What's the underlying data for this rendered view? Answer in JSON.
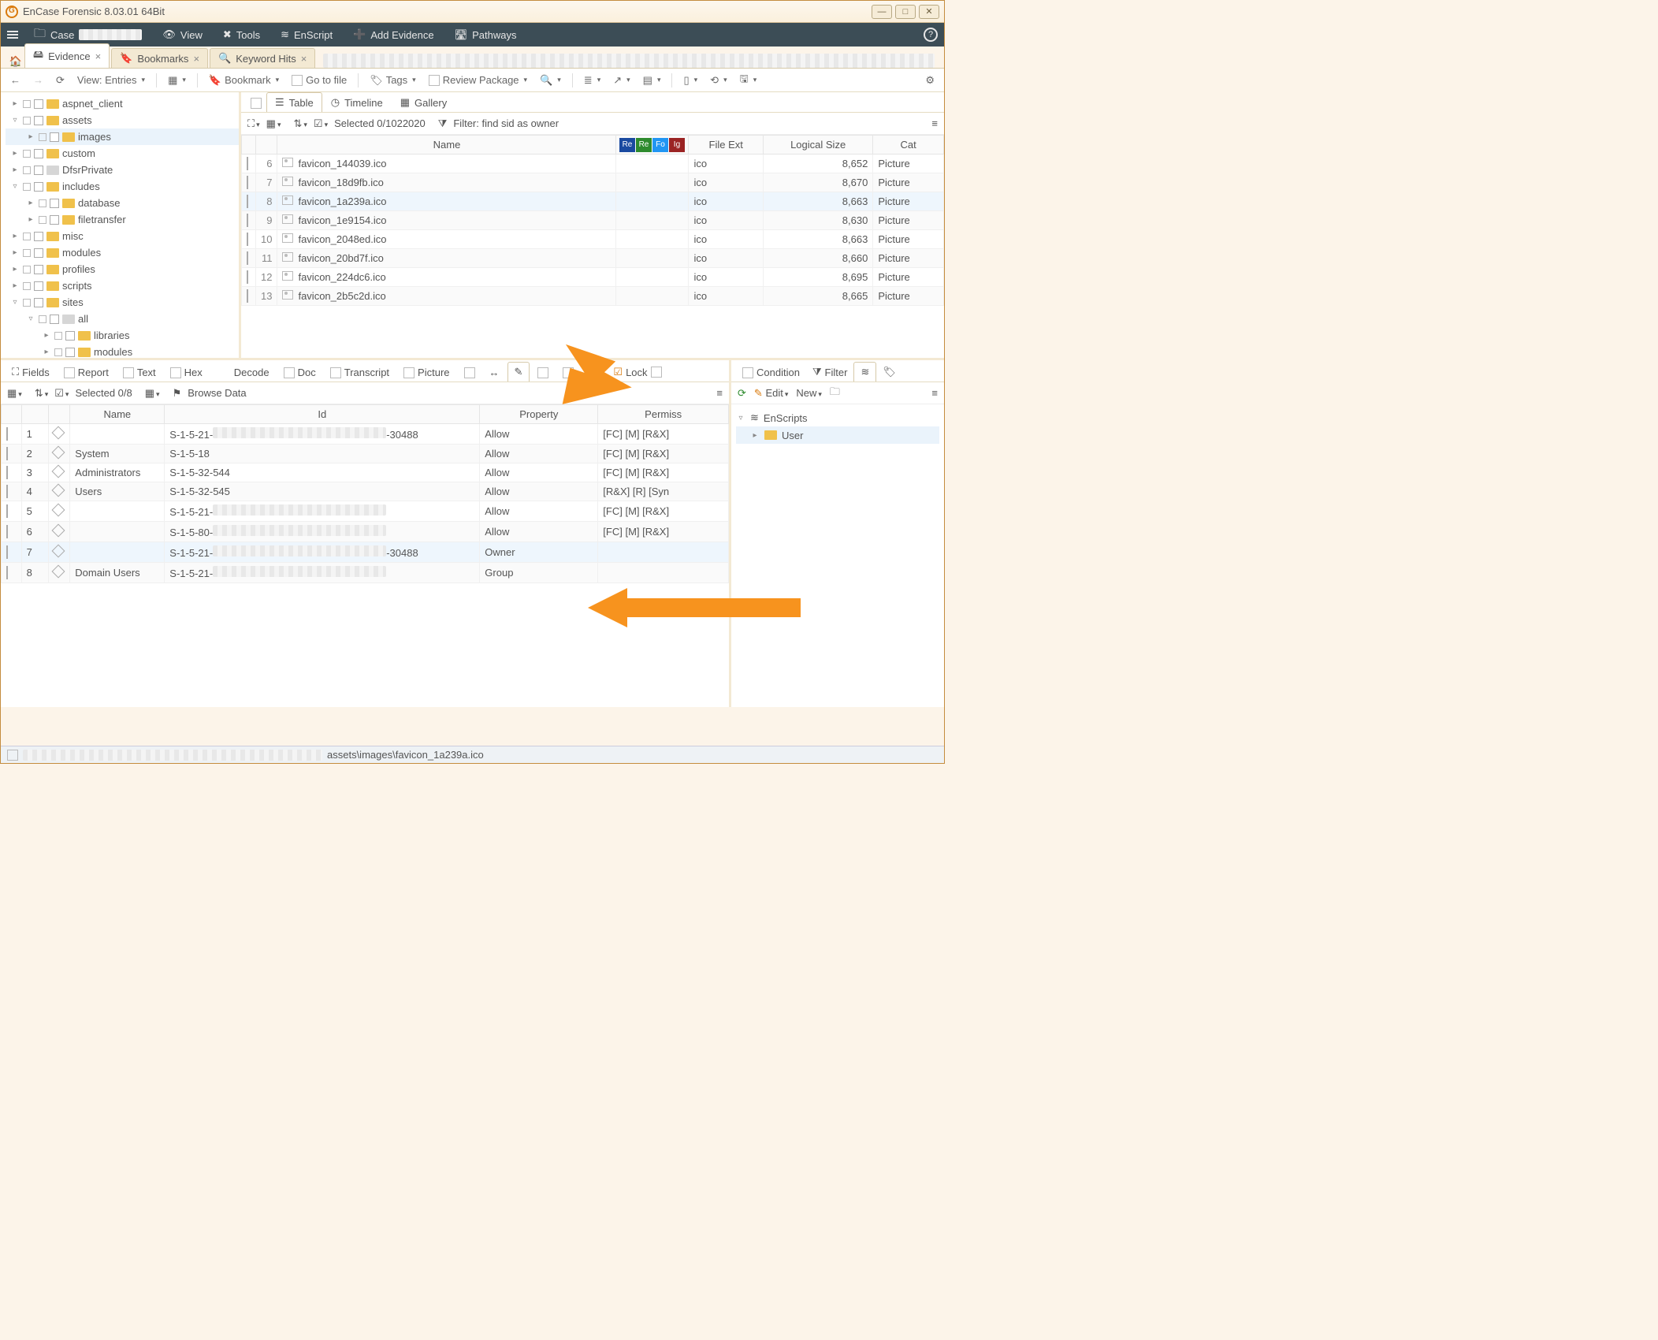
{
  "window": {
    "title": "EnCase Forensic 8.03.01 64Bit"
  },
  "menubar": {
    "case": "Case",
    "view": "View",
    "tools": "Tools",
    "enscript": "EnScript",
    "add_evidence": "Add Evidence",
    "pathways": "Pathways"
  },
  "tabs": {
    "evidence": "Evidence",
    "bookmarks": "Bookmarks",
    "keyword_hits": "Keyword Hits"
  },
  "toolbar": {
    "view_entries": "View: Entries",
    "bookmark": "Bookmark",
    "go_to_file": "Go to file",
    "tags": "Tags",
    "review_package": "Review Package"
  },
  "tree": [
    {
      "label": "aspnet_client",
      "indent": 0,
      "open": false,
      "sel": false
    },
    {
      "label": "assets",
      "indent": 0,
      "open": true,
      "sel": false
    },
    {
      "label": "images",
      "indent": 1,
      "open": false,
      "sel": true
    },
    {
      "label": "custom",
      "indent": 0,
      "open": false,
      "sel": false
    },
    {
      "label": "DfsrPrivate",
      "indent": 0,
      "open": false,
      "sel": false,
      "gray": true
    },
    {
      "label": "includes",
      "indent": 0,
      "open": true,
      "sel": false
    },
    {
      "label": "database",
      "indent": 1,
      "open": false,
      "sel": false
    },
    {
      "label": "filetransfer",
      "indent": 1,
      "open": false,
      "sel": false
    },
    {
      "label": "misc",
      "indent": 0,
      "open": false,
      "sel": false
    },
    {
      "label": "modules",
      "indent": 0,
      "open": false,
      "sel": false
    },
    {
      "label": "profiles",
      "indent": 0,
      "open": false,
      "sel": false
    },
    {
      "label": "scripts",
      "indent": 0,
      "open": false,
      "sel": false
    },
    {
      "label": "sites",
      "indent": 0,
      "open": true,
      "sel": false
    },
    {
      "label": "all",
      "indent": 1,
      "open": true,
      "sel": false,
      "gray": true
    },
    {
      "label": "libraries",
      "indent": 2,
      "open": false,
      "sel": false
    },
    {
      "label": "modules",
      "indent": 2,
      "open": false,
      "sel": false
    }
  ],
  "viewtabs": {
    "table": "Table",
    "timeline": "Timeline",
    "gallery": "Gallery"
  },
  "table_sub": {
    "selected": "Selected 0/1022020",
    "filter": "Filter: find sid as owner"
  },
  "file_table": {
    "headers": {
      "name": "Name",
      "re1": "Re",
      "re2": "Re",
      "fo": "Fo",
      "ig": "Ig",
      "ext": "File Ext",
      "size": "Logical Size",
      "cat": "Cat"
    },
    "rows": [
      {
        "idx": 6,
        "name": "favicon_144039.ico",
        "ext": "ico",
        "size": "8,652",
        "cat": "Picture"
      },
      {
        "idx": 7,
        "name": "favicon_18d9fb.ico",
        "ext": "ico",
        "size": "8,670",
        "cat": "Picture"
      },
      {
        "idx": 8,
        "name": "favicon_1a239a.ico",
        "ext": "ico",
        "size": "8,663",
        "cat": "Picture",
        "sel": true
      },
      {
        "idx": 9,
        "name": "favicon_1e9154.ico",
        "ext": "ico",
        "size": "8,630",
        "cat": "Picture"
      },
      {
        "idx": 10,
        "name": "favicon_2048ed.ico",
        "ext": "ico",
        "size": "8,663",
        "cat": "Picture"
      },
      {
        "idx": 11,
        "name": "favicon_20bd7f.ico",
        "ext": "ico",
        "size": "8,660",
        "cat": "Picture"
      },
      {
        "idx": 12,
        "name": "favicon_224dc6.ico",
        "ext": "ico",
        "size": "8,695",
        "cat": "Picture"
      },
      {
        "idx": 13,
        "name": "favicon_2b5c2d.ico",
        "ext": "ico",
        "size": "8,665",
        "cat": "Picture"
      }
    ]
  },
  "detail_tabs": {
    "fields": "Fields",
    "report": "Report",
    "text": "Text",
    "hex": "Hex",
    "decode": "Decode",
    "doc": "Doc",
    "transcript": "Transcript",
    "picture": "Picture",
    "lock": "Lock"
  },
  "detail_sub": {
    "selected": "Selected 0/8",
    "browse": "Browse Data"
  },
  "detail_table": {
    "headers": {
      "name": "Name",
      "id": "Id",
      "property": "Property",
      "perm": "Permiss"
    },
    "rows": [
      {
        "idx": 1,
        "name": "",
        "id_pre": "S-1-5-21-",
        "id_suf": "-30488",
        "id_blur": true,
        "prop": "Allow",
        "perm": "[FC] [M] [R&X]"
      },
      {
        "idx": 2,
        "name": "System",
        "id": "S-1-5-18",
        "prop": "Allow",
        "perm": "[FC] [M] [R&X]"
      },
      {
        "idx": 3,
        "name": "Administrators",
        "id": "S-1-5-32-544",
        "prop": "Allow",
        "perm": "[FC] [M] [R&X]"
      },
      {
        "idx": 4,
        "name": "Users",
        "id": "S-1-5-32-545",
        "prop": "Allow",
        "perm": "[R&X] [R] [Syn"
      },
      {
        "idx": 5,
        "name": "",
        "id_pre": "S-1-5-21-",
        "id_blur": true,
        "prop": "Allow",
        "perm": "[FC] [M] [R&X]"
      },
      {
        "idx": 6,
        "name": "",
        "id_pre": "S-1-5-80-",
        "id_blur": true,
        "prop": "Allow",
        "perm": "[FC] [M] [R&X]"
      },
      {
        "idx": 7,
        "name": "",
        "id_pre": "S-1-5-21-",
        "id_suf": "-30488",
        "id_blur": true,
        "prop": "Owner",
        "perm": "",
        "hl": true
      },
      {
        "idx": 8,
        "name": "Domain Users",
        "id_pre": "S-1-5-21-",
        "id_blur": true,
        "prop": "Group",
        "perm": ""
      }
    ]
  },
  "side": {
    "condition": "Condition",
    "filter": "Filter",
    "edit": "Edit",
    "new": "New",
    "enscripts": "EnScripts",
    "user": "User"
  },
  "status": {
    "path": "assets\\images\\favicon_1a239a.ico"
  }
}
